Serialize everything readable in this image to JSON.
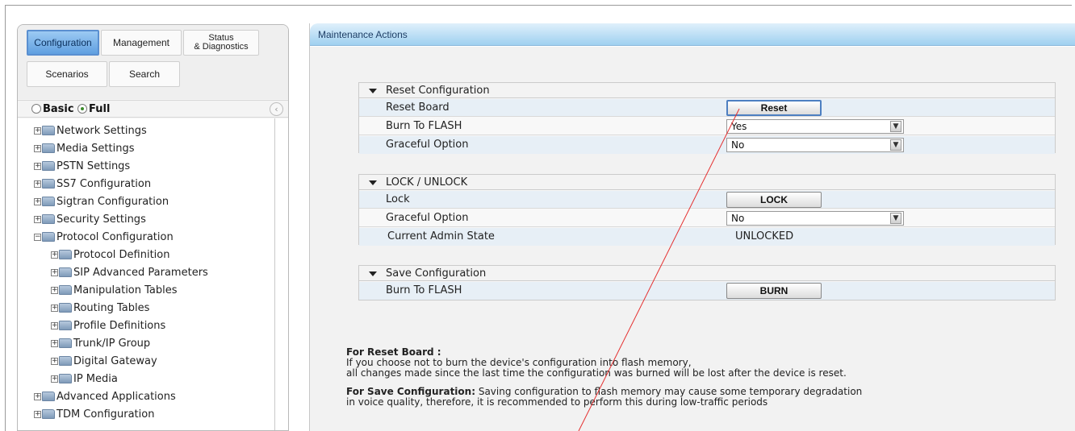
{
  "nav_tabs": [
    {
      "label": "Configuration",
      "active": true
    },
    {
      "label": "Management",
      "active": false
    },
    {
      "label_line1": "Status",
      "label_line2": "& Diagnostics",
      "active": false
    },
    {
      "label": "Scenarios",
      "active": false
    },
    {
      "label": "Search",
      "active": false
    }
  ],
  "mode": {
    "basic_label": "Basic",
    "full_label": "Full",
    "selected": "Full"
  },
  "tree": [
    {
      "label": "Network Settings",
      "level": 0
    },
    {
      "label": "Media Settings",
      "level": 0
    },
    {
      "label": "PSTN Settings",
      "level": 0
    },
    {
      "label": "SS7 Configuration",
      "level": 0
    },
    {
      "label": "Sigtran Configuration",
      "level": 0
    },
    {
      "label": "Security Settings",
      "level": 0
    },
    {
      "label": "Protocol Configuration",
      "level": 0,
      "expanded": true
    },
    {
      "label": "Protocol Definition",
      "level": 1
    },
    {
      "label": "SIP Advanced Parameters",
      "level": 1
    },
    {
      "label": "Manipulation Tables",
      "level": 1
    },
    {
      "label": "Routing Tables",
      "level": 1
    },
    {
      "label": "Profile Definitions",
      "level": 1
    },
    {
      "label": "Trunk/IP Group",
      "level": 1
    },
    {
      "label": "Digital Gateway",
      "level": 1
    },
    {
      "label": "IP Media",
      "level": 1
    },
    {
      "label": "Advanced Applications",
      "level": 0
    },
    {
      "label": "TDM Configuration",
      "level": 0
    }
  ],
  "panel": {
    "title": "Maintenance Actions"
  },
  "reset_section": {
    "title": "Reset Configuration",
    "reset_board_label": "Reset Board",
    "reset_button": "Reset",
    "burn_label": "Burn To FLASH",
    "burn_value": "Yes",
    "graceful_label": "Graceful Option",
    "graceful_value": "No"
  },
  "lock_section": {
    "title": "LOCK / UNLOCK",
    "lock_label": "Lock",
    "lock_button": "LOCK",
    "graceful_label": "Graceful Option",
    "graceful_value": "No",
    "admin_state_label": "Current Admin State",
    "admin_state_value": "UNLOCKED"
  },
  "save_section": {
    "title": "Save Configuration",
    "burn_label": "Burn To FLASH",
    "burn_button": "BURN"
  },
  "notes": {
    "reset_heading": "For Reset Board :",
    "reset_line1": "If you choose not to burn the device's configuration into flash memory,",
    "reset_line2": "all changes made since the last time the configuration was burned will be lost after the device is reset.",
    "save_heading": "For Save Configuration:",
    "save_line1": " Saving configuration to flash memory may cause some temporary degradation",
    "save_line2": "in voice quality, therefore, it is recommended to perform this during low-traffic periods"
  },
  "icons": {
    "dropdown": "chevron-down-icon",
    "collapse": "chevron-left-icon",
    "expand": "plus-icon",
    "folder": "folder-icon"
  },
  "colors": {
    "active_tab": "#5f9fe0",
    "header": "#9fd0f0",
    "annotation_line": "#e53030"
  }
}
